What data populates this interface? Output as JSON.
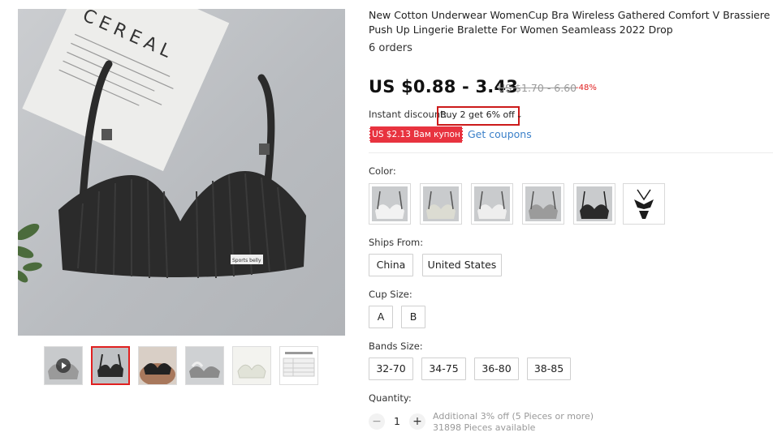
{
  "product": {
    "title": "New Cotton Underwear WomenCup Bra Wireless Gathered Comfort V Brassiere Push Up Lingerie Bralette For Women Seamleass 2022 Drop",
    "orders": "6 orders",
    "price": "US $0.88 - 3.43",
    "old_price": "US $1.70 - 6.60",
    "discount_pct": "-48%"
  },
  "photo": {
    "card_text": "CEREAL",
    "tag_text": "Sports belly"
  },
  "promo": {
    "instant_label": "Instant discount:",
    "instant_offer": "Buy 2 get 6% off",
    "chevron": "⌄",
    "coupon_badge": "US $2.13 Вам купон",
    "get_coupons": "Get coupons"
  },
  "color": {
    "label": "Color:",
    "swatch_colors": [
      "#f2f2f2",
      "#dcdcd2",
      "#eeeeee",
      "#c9c9c9",
      "#2a2a2a",
      "#1c1c1c"
    ]
  },
  "ships_from": {
    "label": "Ships From:",
    "options": [
      "China",
      "United States"
    ]
  },
  "cup_size": {
    "label": "Cup Size:",
    "options": [
      "A",
      "B"
    ]
  },
  "bands_size": {
    "label": "Bands Size:",
    "options": [
      "32-70",
      "34-75",
      "36-80",
      "38-85"
    ]
  },
  "quantity": {
    "label": "Quantity:",
    "minus": "−",
    "plus": "+",
    "value": "1",
    "note_line1": "Additional 3% off (5 Pieces or more)",
    "note_line2": "31898 Pieces available"
  },
  "colors": {
    "price_red": "#e02020",
    "coupon_red": "#e8333f",
    "link_blue": "#3b80c9",
    "bra_black": "#2b2b2b"
  }
}
